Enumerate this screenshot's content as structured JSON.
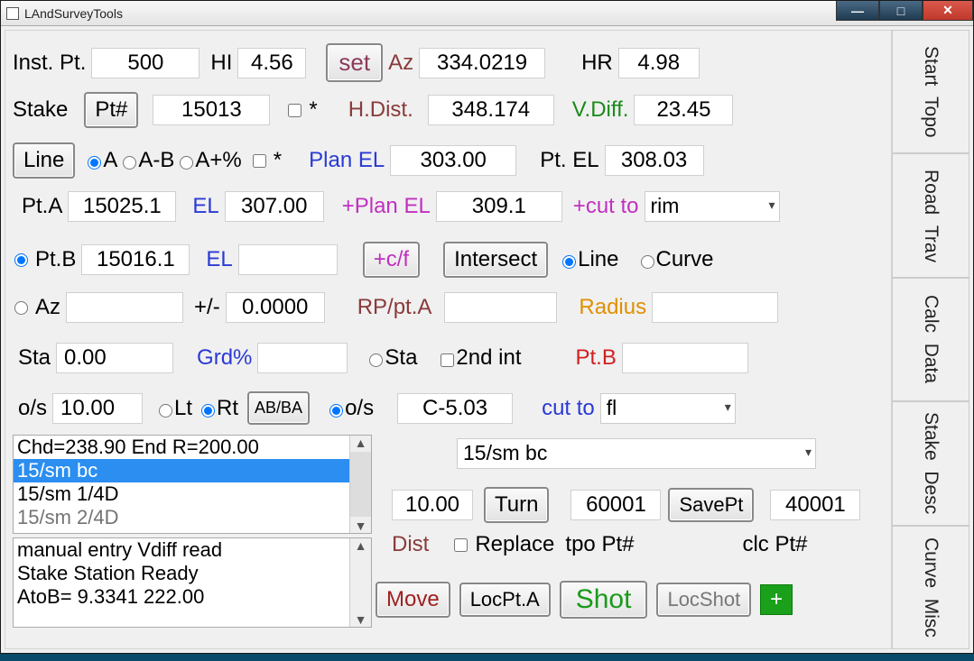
{
  "app_title": "LAndSurveyTools",
  "row1": {
    "inst_pt_label": "Inst. Pt.",
    "inst_pt": "500",
    "hi_label": "HI",
    "hi": "4.56",
    "set_btn": "set",
    "az_label": "Az",
    "az": "334.0219",
    "hr_label": "HR",
    "hr": "4.98"
  },
  "row2": {
    "stake_label": "Stake",
    "ptnum_btn": "Pt#",
    "pt_val": "15013",
    "star": "*",
    "hdist_label": "H.Dist.",
    "hdist": "348.174",
    "vdiff_label": "V.Diff.",
    "vdiff": "23.45"
  },
  "row3": {
    "line_btn": "Line",
    "ra": "A",
    "rab": "A-B",
    "rapct": "A+%",
    "star": "*",
    "planel_label": "Plan EL",
    "planel": "303.00",
    "ptel_label": "Pt. EL",
    "ptel": "308.03"
  },
  "row4": {
    "pta_label": "Pt.A",
    "pta": "15025.1",
    "el_label": "EL",
    "el": "307.00",
    "pplanel_label": "+Plan EL",
    "pplanel": "309.1",
    "cutto_label": "+cut to",
    "cutto": "rim"
  },
  "row5": {
    "ptb_label": "Pt.B",
    "ptb": "15016.1",
    "el_label": "EL",
    "cf_btn": "+c/f",
    "intersect_btn": "Intersect",
    "line_label": "Line",
    "curve_label": "Curve"
  },
  "row6": {
    "az_label": "Az",
    "pm_label": "+/-",
    "pm_val": "0.0000",
    "rp_label": "RP/pt.A",
    "radius_label": "Radius"
  },
  "row7": {
    "sta_label": "Sta",
    "sta": "0.00",
    "grd_label": "Grd%",
    "sta_r_label": "Sta",
    "int2_label": "2nd int",
    "ptb_label": "Pt.B"
  },
  "row8": {
    "os_label": "o/s",
    "os": "10.00",
    "lt_label": "Lt",
    "rt_label": "Rt",
    "abba_btn": "AB/BA",
    "os_r_label": "o/s",
    "os_r_val": "C-5.03",
    "cutto_label": "cut to",
    "cutto_val": "fl"
  },
  "listA": {
    "i0": "Chd=238.90 End R=200.00",
    "i1": "15/sm bc",
    "i2": "15/sm 1/4D",
    "i3": "15/sm 2/4D"
  },
  "desc_select": "15/sm bc",
  "row10": {
    "dist_val": "10.00",
    "turn_btn": "Turn",
    "tpo_val": "60001",
    "save_btn": "SavePt",
    "clc_val": "40001"
  },
  "row11": {
    "dist_label": "Dist",
    "replace_label": "Replace",
    "tponum_label": "tpo Pt#",
    "clcnum_label": "clc Pt#"
  },
  "listB": {
    "l0": "manual entry Vdiff read",
    "l1": "Stake Station Ready",
    "l2": "AtoB= 9.3341  222.00"
  },
  "row12": {
    "move_btn": "Move",
    "locpta_btn": "LocPt.A",
    "shot_btn": "Shot",
    "locshot_btn": "LocShot"
  },
  "tabs": {
    "t1a": "Start",
    "t1b": "Topo",
    "t2a": "Road",
    "t2b": "Trav",
    "t3a": "Calc",
    "t3b": "Data",
    "t4a": "Stake",
    "t4b": "Desc",
    "t5a": "Curve",
    "t5b": "Misc"
  }
}
